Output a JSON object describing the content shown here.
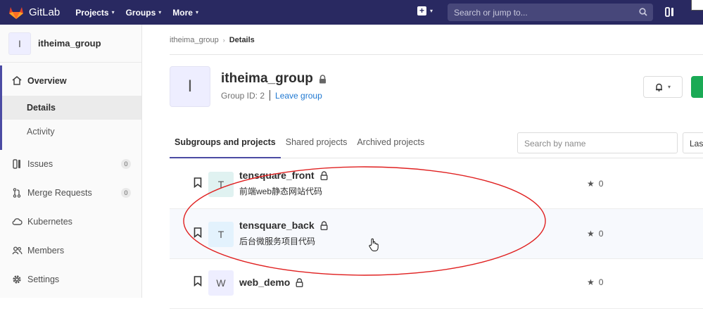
{
  "brand": {
    "name": "GitLab"
  },
  "topnav": {
    "items": [
      "Projects",
      "Groups",
      "More"
    ],
    "search_placeholder": "Search or jump to..."
  },
  "sidebar": {
    "group_initial": "I",
    "group_name": "itheima_group",
    "overview": "Overview",
    "details": "Details",
    "activity": "Activity",
    "issues": "Issues",
    "issues_count": "0",
    "merge_requests": "Merge Requests",
    "mr_count": "0",
    "kubernetes": "Kubernetes",
    "members": "Members",
    "settings": "Settings"
  },
  "breadcrumb": {
    "parent": "itheima_group",
    "current": "Details"
  },
  "group": {
    "initial": "I",
    "name": "itheima_group",
    "id_text": "Group ID: 2",
    "leave": "Leave group"
  },
  "tabs": [
    "Subgroups and projects",
    "Shared projects",
    "Archived projects"
  ],
  "filter": {
    "placeholder": "Search by name",
    "sort_label": "Las"
  },
  "projects": [
    {
      "initial": "T",
      "name": "tensquare_front",
      "description": "前端web静态网站代码",
      "stars": "0",
      "avatar_color": "#e0f2f1"
    },
    {
      "initial": "T",
      "name": "tensquare_back",
      "description": "后台微服务项目代码",
      "stars": "0",
      "avatar_color": "#e3f2fd"
    },
    {
      "initial": "W",
      "name": "web_demo",
      "description": "",
      "stars": "0",
      "avatar_color": "#eeeeff"
    }
  ],
  "colors": {
    "nav_bg": "#292961",
    "accent": "#4b4ba3",
    "link": "#1f78d1",
    "annotation": "#e02020"
  }
}
